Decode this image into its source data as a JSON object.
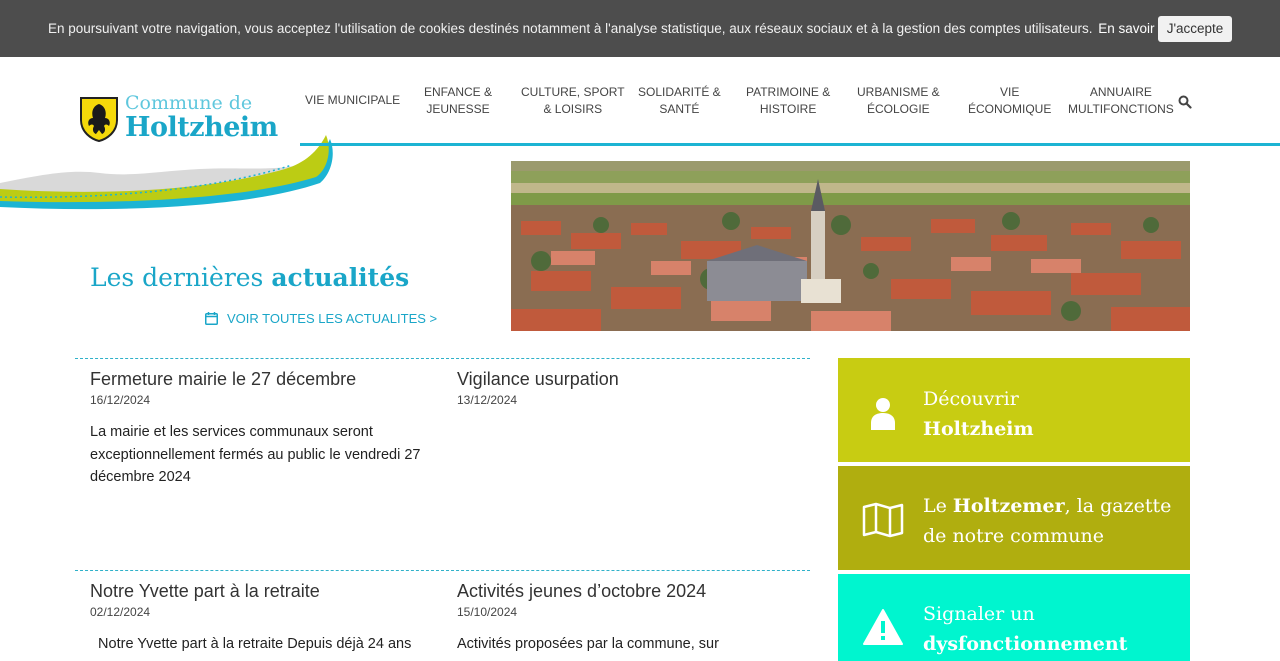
{
  "cookie": {
    "message": "En poursuivant votre navigation, vous acceptez l'utilisation de cookies destinés notamment à l'analyse statistique, aux réseaux sociaux et à la gestion des comptes utilisateurs.",
    "more_link": "En savoir plus",
    "accept_label": "J'accepte"
  },
  "logo": {
    "line1": "Commune de",
    "line2": "Holtzheim"
  },
  "nav": {
    "items": [
      {
        "l1": "VIE MUNICIPALE",
        "l2": ""
      },
      {
        "l1": "ENFANCE &",
        "l2": "JEUNESSE"
      },
      {
        "l1": "CULTURE, SPORT",
        "l2": "& LOISIRS"
      },
      {
        "l1": "SOLIDARITÉ &",
        "l2": "SANTÉ"
      },
      {
        "l1": "PATRIMOINE &",
        "l2": "HISTOIRE"
      },
      {
        "l1": "URBANISME &",
        "l2": "ÉCOLOGIE"
      },
      {
        "l1": "VIE",
        "l2": "ÉCONOMIQUE"
      },
      {
        "l1": "ANNUAIRE",
        "l2": "MULTIFONCTIONS"
      }
    ]
  },
  "news_section": {
    "title_plain": "Les dernières",
    "title_bold": "actualités",
    "see_all": "VOIR TOUTES LES ACTUALITES >"
  },
  "news": [
    {
      "title": "Fermeture mairie le 27 décembre",
      "date": "16/12/2024",
      "excerpt": "La mairie et les services communaux seront exceptionnellement fermés au public le vendredi 27 décembre 2024"
    },
    {
      "title": "Vigilance usurpation",
      "date": "13/12/2024",
      "excerpt": ""
    },
    {
      "title": "Notre Yvette part à la retraite",
      "date": "02/12/2024",
      "excerpt": "  Notre Yvette part à la retraite Depuis déjà 24 ans"
    },
    {
      "title": "Activités jeunes d’octobre 2024",
      "date": "15/10/2024",
      "excerpt": "Activités proposées par la commune, sur"
    }
  ],
  "tiles": [
    {
      "pre": "Découvrir",
      "bold": "Holtzheim",
      "post": "",
      "color": "#c8cc12"
    },
    {
      "pre": "Le",
      "bold": "Holtzemer",
      "post": ", la gazette de notre commune",
      "color": "#b0ae0f"
    },
    {
      "pre": "Signaler un",
      "bold": "dysfonctionnement",
      "post": "",
      "color": "#00f5cf"
    }
  ]
}
